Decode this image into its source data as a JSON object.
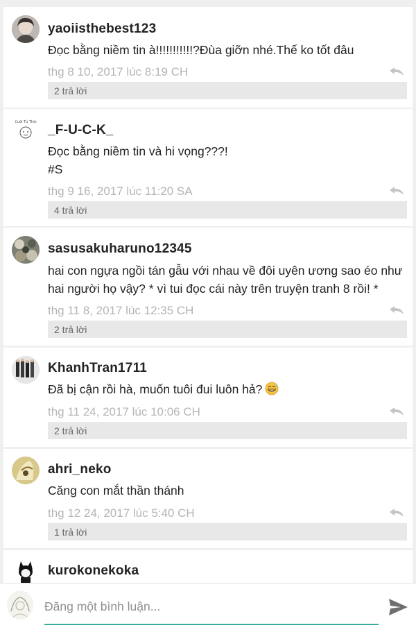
{
  "comments": [
    {
      "username": "yaoiisthebest123",
      "lines": [
        "Đọc bằng niềm tin à!!!!!!!!!!!?Đùa giỡn nhé.Thế ko tốt đâu"
      ],
      "timestamp": "thg 8 10, 2017 lúc 8:19 CH",
      "replies": "2 trả lời",
      "avatar": "photo-avatar-icon"
    },
    {
      "username": "_F-U-C-K_",
      "lines": [
        "Đọc bằng niềm tin và hi vọng???!",
        "#S"
      ],
      "timestamp": "thg 9 16, 2017 lúc 11:20 SA",
      "replies": "4 trả lời",
      "avatar": "sketch-avatar-icon",
      "avatar_caption": "Cuối Tủ Thôi"
    },
    {
      "username": "sasusakuharuno12345",
      "lines": [
        "hai con ngựa ngồi tán gẫu với nhau về đôi uyên ương sao éo như",
        "hai người họ vậy? * vì tui đọc cái này trên truyện tranh 8 rồi! *"
      ],
      "timestamp": "thg 11 8, 2017 lúc 12:35 CH",
      "replies": "2 trả lời",
      "avatar": "anime-avatar-icon"
    },
    {
      "username": "KhanhTran1711",
      "lines": [
        "Đã bị cận rồi hà, muốn tuôi đui luôn hả?"
      ],
      "emoji": "grinning-sweat-emoji-icon",
      "timestamp": "thg 11 24, 2017 lúc 10:06 CH",
      "replies": "2 trả lời",
      "avatar": "group-photo-avatar-icon"
    },
    {
      "username": "ahri_neko",
      "lines": [
        "Căng con mắt thần thánh"
      ],
      "timestamp": "thg 12 24, 2017 lúc 5:40 CH",
      "replies": "1 trả lời",
      "avatar": "anime-avatar-icon"
    },
    {
      "username": "kurokonekoka",
      "lines": [],
      "avatar": "cat-girl-avatar-icon"
    }
  ],
  "composer": {
    "placeholder": "Đăng một bình luận...",
    "send_icon": "send-icon",
    "accent": "#3aa9a0"
  },
  "colors": {
    "background": "#efefef",
    "timestamp": "#b5b5b5",
    "replies_bar": "#e8e8e8"
  }
}
